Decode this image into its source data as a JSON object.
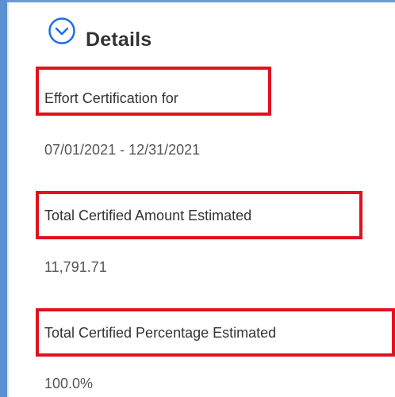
{
  "section": {
    "title": "Details",
    "toggle_icon": "chevron-down-circle-icon",
    "accent_color": "#1b6ee8"
  },
  "fields": [
    {
      "label": "Effort Certification for",
      "value": "07/01/2021 - 12/31/2021"
    },
    {
      "label": "Total Certified Amount Estimated",
      "value": "11,791.71"
    },
    {
      "label": "Total Certified Percentage Estimated",
      "value": "100.0%"
    }
  ],
  "highlight_color": "#e3101e"
}
